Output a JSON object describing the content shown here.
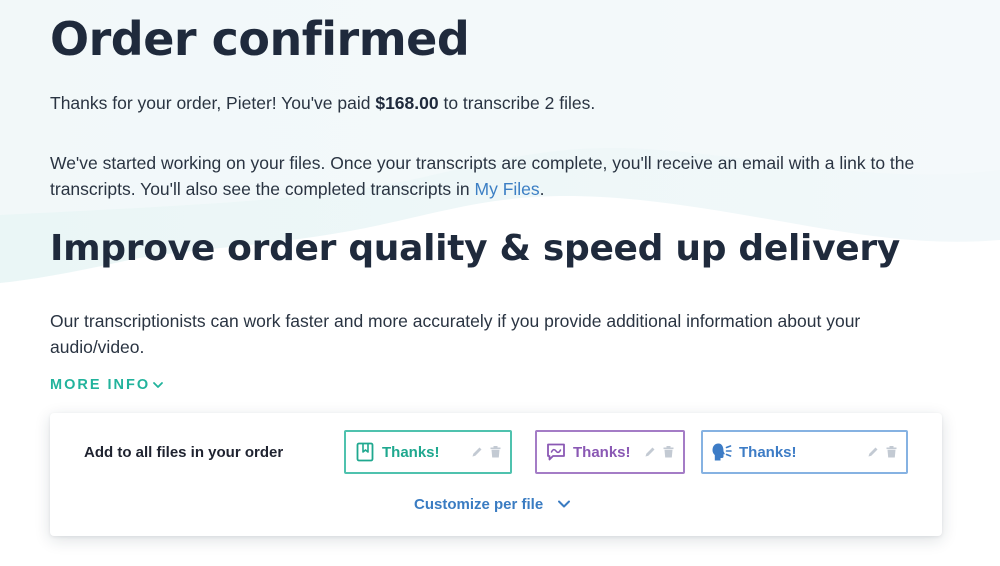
{
  "header": {
    "title": "Order confirmed"
  },
  "confirmation": {
    "thanks_prefix": "Thanks for your order, Pieter! You've paid ",
    "amount": "$168.00",
    "thanks_suffix": " to transcribe 2 files."
  },
  "status": {
    "text_before_link": "We've started working on your files. Once your transcripts are complete, you'll receive an email with a link to the transcripts. You'll also see the completed transcripts in ",
    "link_label": "My Files",
    "text_after_link": "."
  },
  "improve": {
    "title": "Improve order quality & speed up delivery",
    "description": "Our transcriptionists can work faster and more accurately if you provide additional information about your audio/video.",
    "more_info_label": "MORE INFO"
  },
  "card": {
    "label": "Add to all files in your order",
    "chips": [
      {
        "label": "Thanks!",
        "icon": "bookmark-note-icon",
        "color": "#1fa88f"
      },
      {
        "label": "Thanks!",
        "icon": "chat-note-icon",
        "color": "#8a58b4"
      },
      {
        "label": "Thanks!",
        "icon": "speaker-voice-icon",
        "color": "#3d7cc6"
      }
    ],
    "customize_label": "Customize per file"
  },
  "colors": {
    "heading": "#1f2a3c",
    "link": "#3c7fc4",
    "accent_teal": "#22b39c",
    "chip_green": "#4fc2ae",
    "chip_purple": "#a47cc6",
    "chip_blue": "#86b2e2"
  }
}
